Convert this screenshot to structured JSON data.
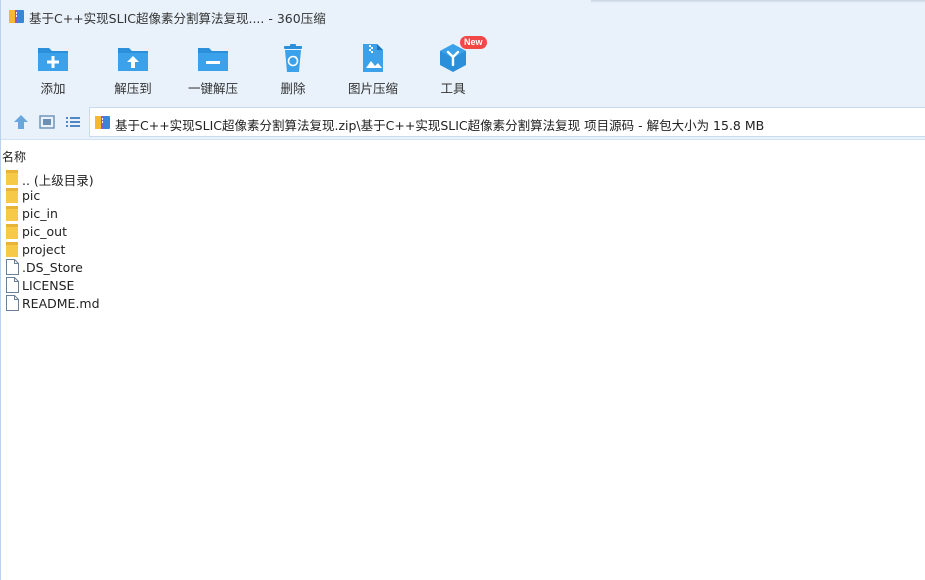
{
  "window": {
    "title": "基于C++实现SLIC超像素分割算法复现.... - 360压缩"
  },
  "toolbar": {
    "add": "添加",
    "extract_to": "解压到",
    "one_click_extract": "一键解压",
    "delete": "删除",
    "image_compress": "图片压缩",
    "tools": "工具",
    "tools_badge": "New"
  },
  "addressbar": {
    "path": "基于C++实现SLIC超像素分割算法复现.zip\\基于C++实现SLIC超像素分割算法复现 项目源码 - 解包大小为 15.8 MB"
  },
  "list": {
    "column_name": "名称",
    "items": [
      {
        "name": ".. (上级目录)",
        "type": "folder"
      },
      {
        "name": "pic",
        "type": "folder"
      },
      {
        "name": "pic_in",
        "type": "folder"
      },
      {
        "name": "pic_out",
        "type": "folder"
      },
      {
        "name": "project",
        "type": "folder"
      },
      {
        "name": ".DS_Store",
        "type": "file"
      },
      {
        "name": "LICENSE",
        "type": "file"
      },
      {
        "name": "README.md",
        "type": "file"
      }
    ]
  },
  "colors": {
    "accent": "#2b8fd9",
    "toolbar_bg": "#e9f2fb",
    "folder": "#f7c948",
    "badge": "#f04848"
  }
}
